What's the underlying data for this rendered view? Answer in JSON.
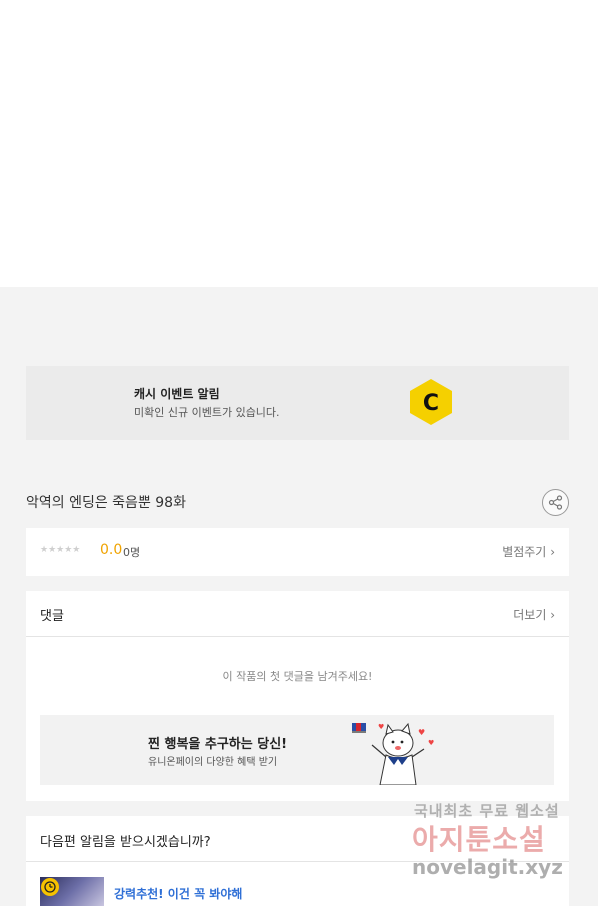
{
  "cash_event": {
    "title": "캐시 이벤트 알림",
    "subtitle": "미확인 신규 이벤트가 있습니다.",
    "logo_letter": "C",
    "accent": "#f5d000"
  },
  "episode": {
    "title": "악역의 엔딩은 죽음뿐 98화"
  },
  "rating": {
    "stars": "★★★★★",
    "score": "0.0",
    "count": "0명",
    "rate_link": "별점주기"
  },
  "comments": {
    "title": "댓글",
    "more": "더보기",
    "empty_message": "이 작품의 첫 댓글을 남겨주세요!"
  },
  "ad": {
    "title": "찐 행복을 추구하는 당신!",
    "subtitle": "유니온페이의 다양한 혜택 받기"
  },
  "notify": {
    "title": "다음편 알림을 받으시겠습니까?",
    "recommend": "강력추천! 이건 꼭 봐야해"
  },
  "watermark": {
    "line1": "국내최초 무료 웹소설",
    "line2": "아지툰소설",
    "line3": "novelagit.xyz"
  }
}
